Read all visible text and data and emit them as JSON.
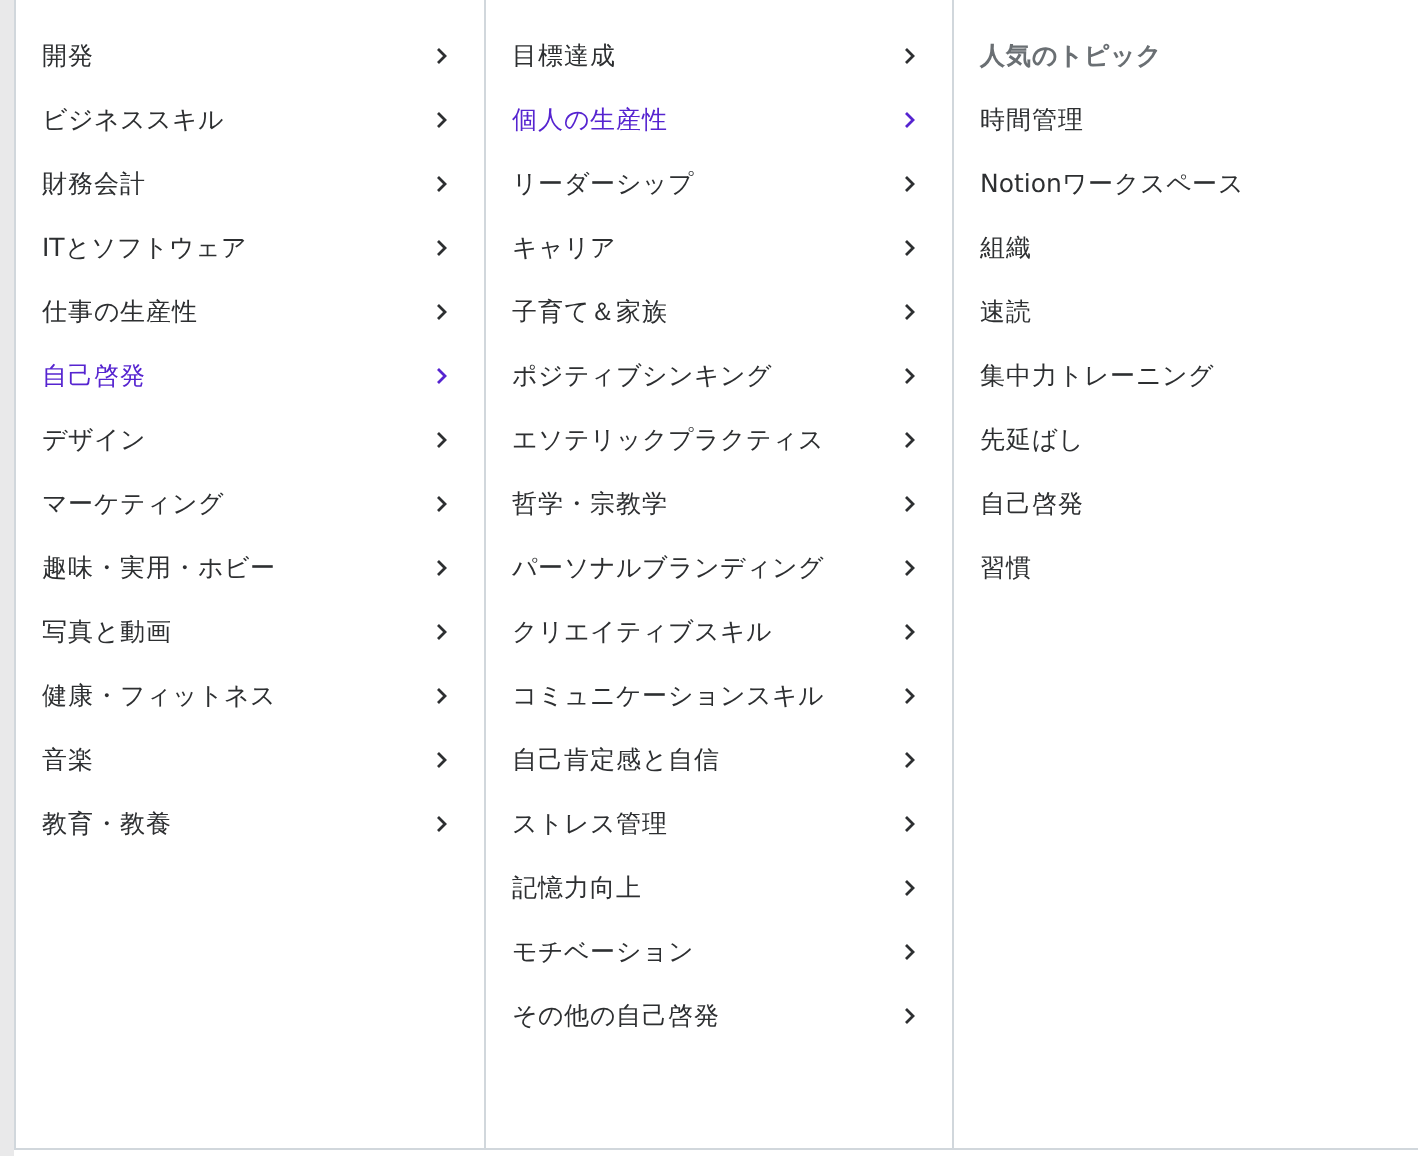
{
  "categories": [
    {
      "label": "開発",
      "selected": false
    },
    {
      "label": "ビジネススキル",
      "selected": false
    },
    {
      "label": "財務会計",
      "selected": false
    },
    {
      "label": "ITとソフトウェア",
      "selected": false
    },
    {
      "label": "仕事の生産性",
      "selected": false
    },
    {
      "label": "自己啓発",
      "selected": true
    },
    {
      "label": "デザイン",
      "selected": false
    },
    {
      "label": "マーケティング",
      "selected": false
    },
    {
      "label": "趣味・実用・ホビー",
      "selected": false
    },
    {
      "label": "写真と動画",
      "selected": false
    },
    {
      "label": "健康・フィットネス",
      "selected": false
    },
    {
      "label": "音楽",
      "selected": false
    },
    {
      "label": "教育・教養",
      "selected": false
    }
  ],
  "subcategories": [
    {
      "label": "目標達成",
      "selected": false
    },
    {
      "label": "個人の生産性",
      "selected": true
    },
    {
      "label": "リーダーシップ",
      "selected": false
    },
    {
      "label": "キャリア",
      "selected": false
    },
    {
      "label": "子育て＆家族",
      "selected": false
    },
    {
      "label": "ポジティブシンキング",
      "selected": false
    },
    {
      "label": "エソテリックプラクティス",
      "selected": false
    },
    {
      "label": "哲学・宗教学",
      "selected": false
    },
    {
      "label": "パーソナルブランディング",
      "selected": false
    },
    {
      "label": "クリエイティブスキル",
      "selected": false
    },
    {
      "label": "コミュニケーションスキル",
      "selected": false
    },
    {
      "label": "自己肯定感と自信",
      "selected": false
    },
    {
      "label": "ストレス管理",
      "selected": false
    },
    {
      "label": "記憶力向上",
      "selected": false
    },
    {
      "label": "モチベーション",
      "selected": false
    },
    {
      "label": "その他の自己啓発",
      "selected": false
    }
  ],
  "popular_topics": {
    "title": "人気のトピック",
    "items": [
      "時間管理",
      "Notionワークスペース",
      "組織",
      "速読",
      "集中力トレーニング",
      "先延ばし",
      "自己啓発",
      "習慣"
    ]
  }
}
